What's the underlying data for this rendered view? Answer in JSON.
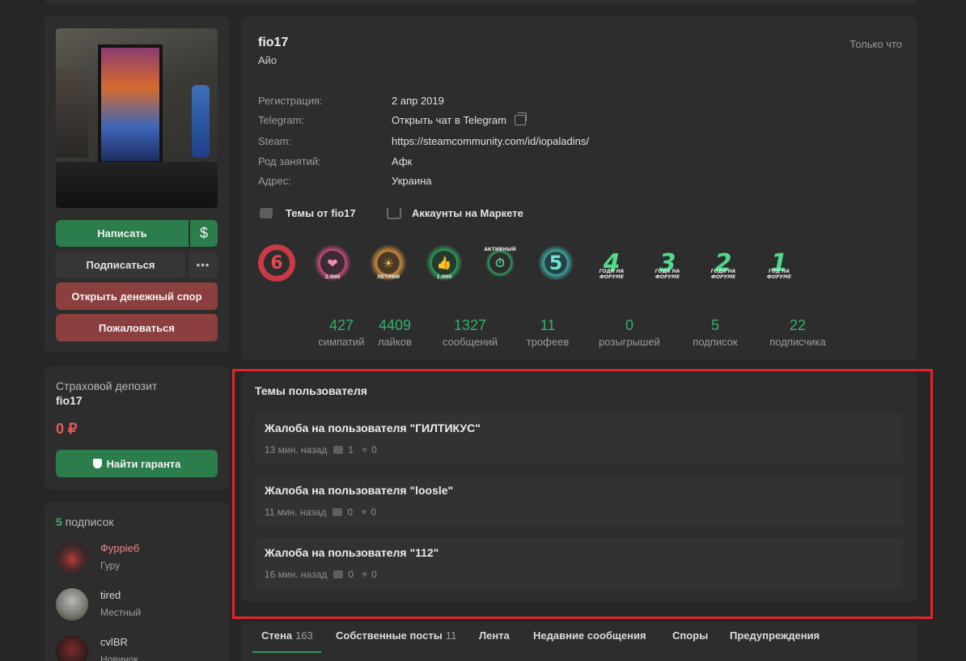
{
  "profile": {
    "username": "fio17",
    "status": "Айо",
    "last_seen": "Только что",
    "fields": [
      {
        "label": "Регистрация:",
        "value": "2 апр 2019"
      },
      {
        "label": "Telegram:",
        "value": "Открыть чат в Telegram"
      },
      {
        "label": "Steam:",
        "value": "https://steamcommunity.com/id/iopaladins/"
      },
      {
        "label": "Род занятий:",
        "value": "Афк"
      },
      {
        "label": "Адрес:",
        "value": "Украина"
      }
    ],
    "links": {
      "topics": "Темы от fio17",
      "market": "Аккаунты на Маркете"
    }
  },
  "actions": {
    "write": "Написать",
    "dollar": "$",
    "subscribe": "Подписаться",
    "more": "•••",
    "dispute": "Открыть денежный спор",
    "report": "Пожаловаться"
  },
  "trophies": [
    {
      "label": "6",
      "caption": "",
      "color": "#c93a45"
    },
    {
      "label": "❤",
      "caption": "2.500",
      "color": "#c94a7a"
    },
    {
      "label": "☀",
      "caption": "ЛЕТНИЙ",
      "color": "#c98a3a"
    },
    {
      "label": "👍",
      "caption": "1.000",
      "color": "#2f9a5a"
    },
    {
      "label": "⏱",
      "caption": "АКТИВНЫЙ",
      "color": "#2f9a5a"
    },
    {
      "label": "5",
      "caption": "",
      "color": "#3aa39a"
    },
    {
      "label": "4",
      "caption": "ГОДА НА ФОРУМЕ",
      "color": "#2f9a5a"
    },
    {
      "label": "3",
      "caption": "ГОДА НА ФОРУМЕ",
      "color": "#2f9a5a"
    },
    {
      "label": "2",
      "caption": "ГОДА НА ФОРУМЕ",
      "color": "#2f9a5a"
    },
    {
      "label": "1",
      "caption": "ГОД НА ФОРУМЕ",
      "color": "#2f9a5a"
    }
  ],
  "stats": [
    {
      "value": "427",
      "label": "симпатий"
    },
    {
      "value": "4409",
      "label": "лайков"
    },
    {
      "value": "1327",
      "label": "сообщений"
    },
    {
      "value": "11",
      "label": "трофеев"
    },
    {
      "value": "0",
      "label": "розыгрышей"
    },
    {
      "value": "5",
      "label": "подписок"
    },
    {
      "value": "22",
      "label": "подписчика"
    }
  ],
  "deposit": {
    "title": "Страховой депозит",
    "user": "fio17",
    "amount": "0 ₽",
    "button": "Найти гаранта"
  },
  "subscriptions": {
    "count": "5",
    "title": "подписок",
    "items": [
      {
        "name": "Фуррieб",
        "rank": "Гуру",
        "name_color": "#e98a8a"
      },
      {
        "name": "tired",
        "rank": "Местный",
        "name_color": "#cfcfcf"
      },
      {
        "name": "cvlBR",
        "rank": "Новичок",
        "name_color": "#cfcfcf"
      }
    ]
  },
  "topics": {
    "title": "Темы пользователя",
    "items": [
      {
        "title": "Жалоба на пользователя \"ГИЛТИКУС\"",
        "time": "13 мин. назад",
        "comments": "1",
        "likes": "0"
      },
      {
        "title": "Жалоба на пользователя \"loosle\"",
        "time": "11 мин. назад",
        "comments": "0",
        "likes": "0"
      },
      {
        "title": "Жалоба на пользователя \"112\"",
        "time": "16 мин. назад",
        "comments": "0",
        "likes": "0"
      }
    ]
  },
  "tabs": [
    {
      "label": "Стена",
      "count": "163"
    },
    {
      "label": "Собственные посты",
      "count": "11"
    },
    {
      "label": "Лента",
      "count": ""
    },
    {
      "label": "Недавние сообщения",
      "count": ""
    },
    {
      "label": "Споры",
      "count": ""
    },
    {
      "label": "Предупреждения",
      "count": ""
    }
  ]
}
